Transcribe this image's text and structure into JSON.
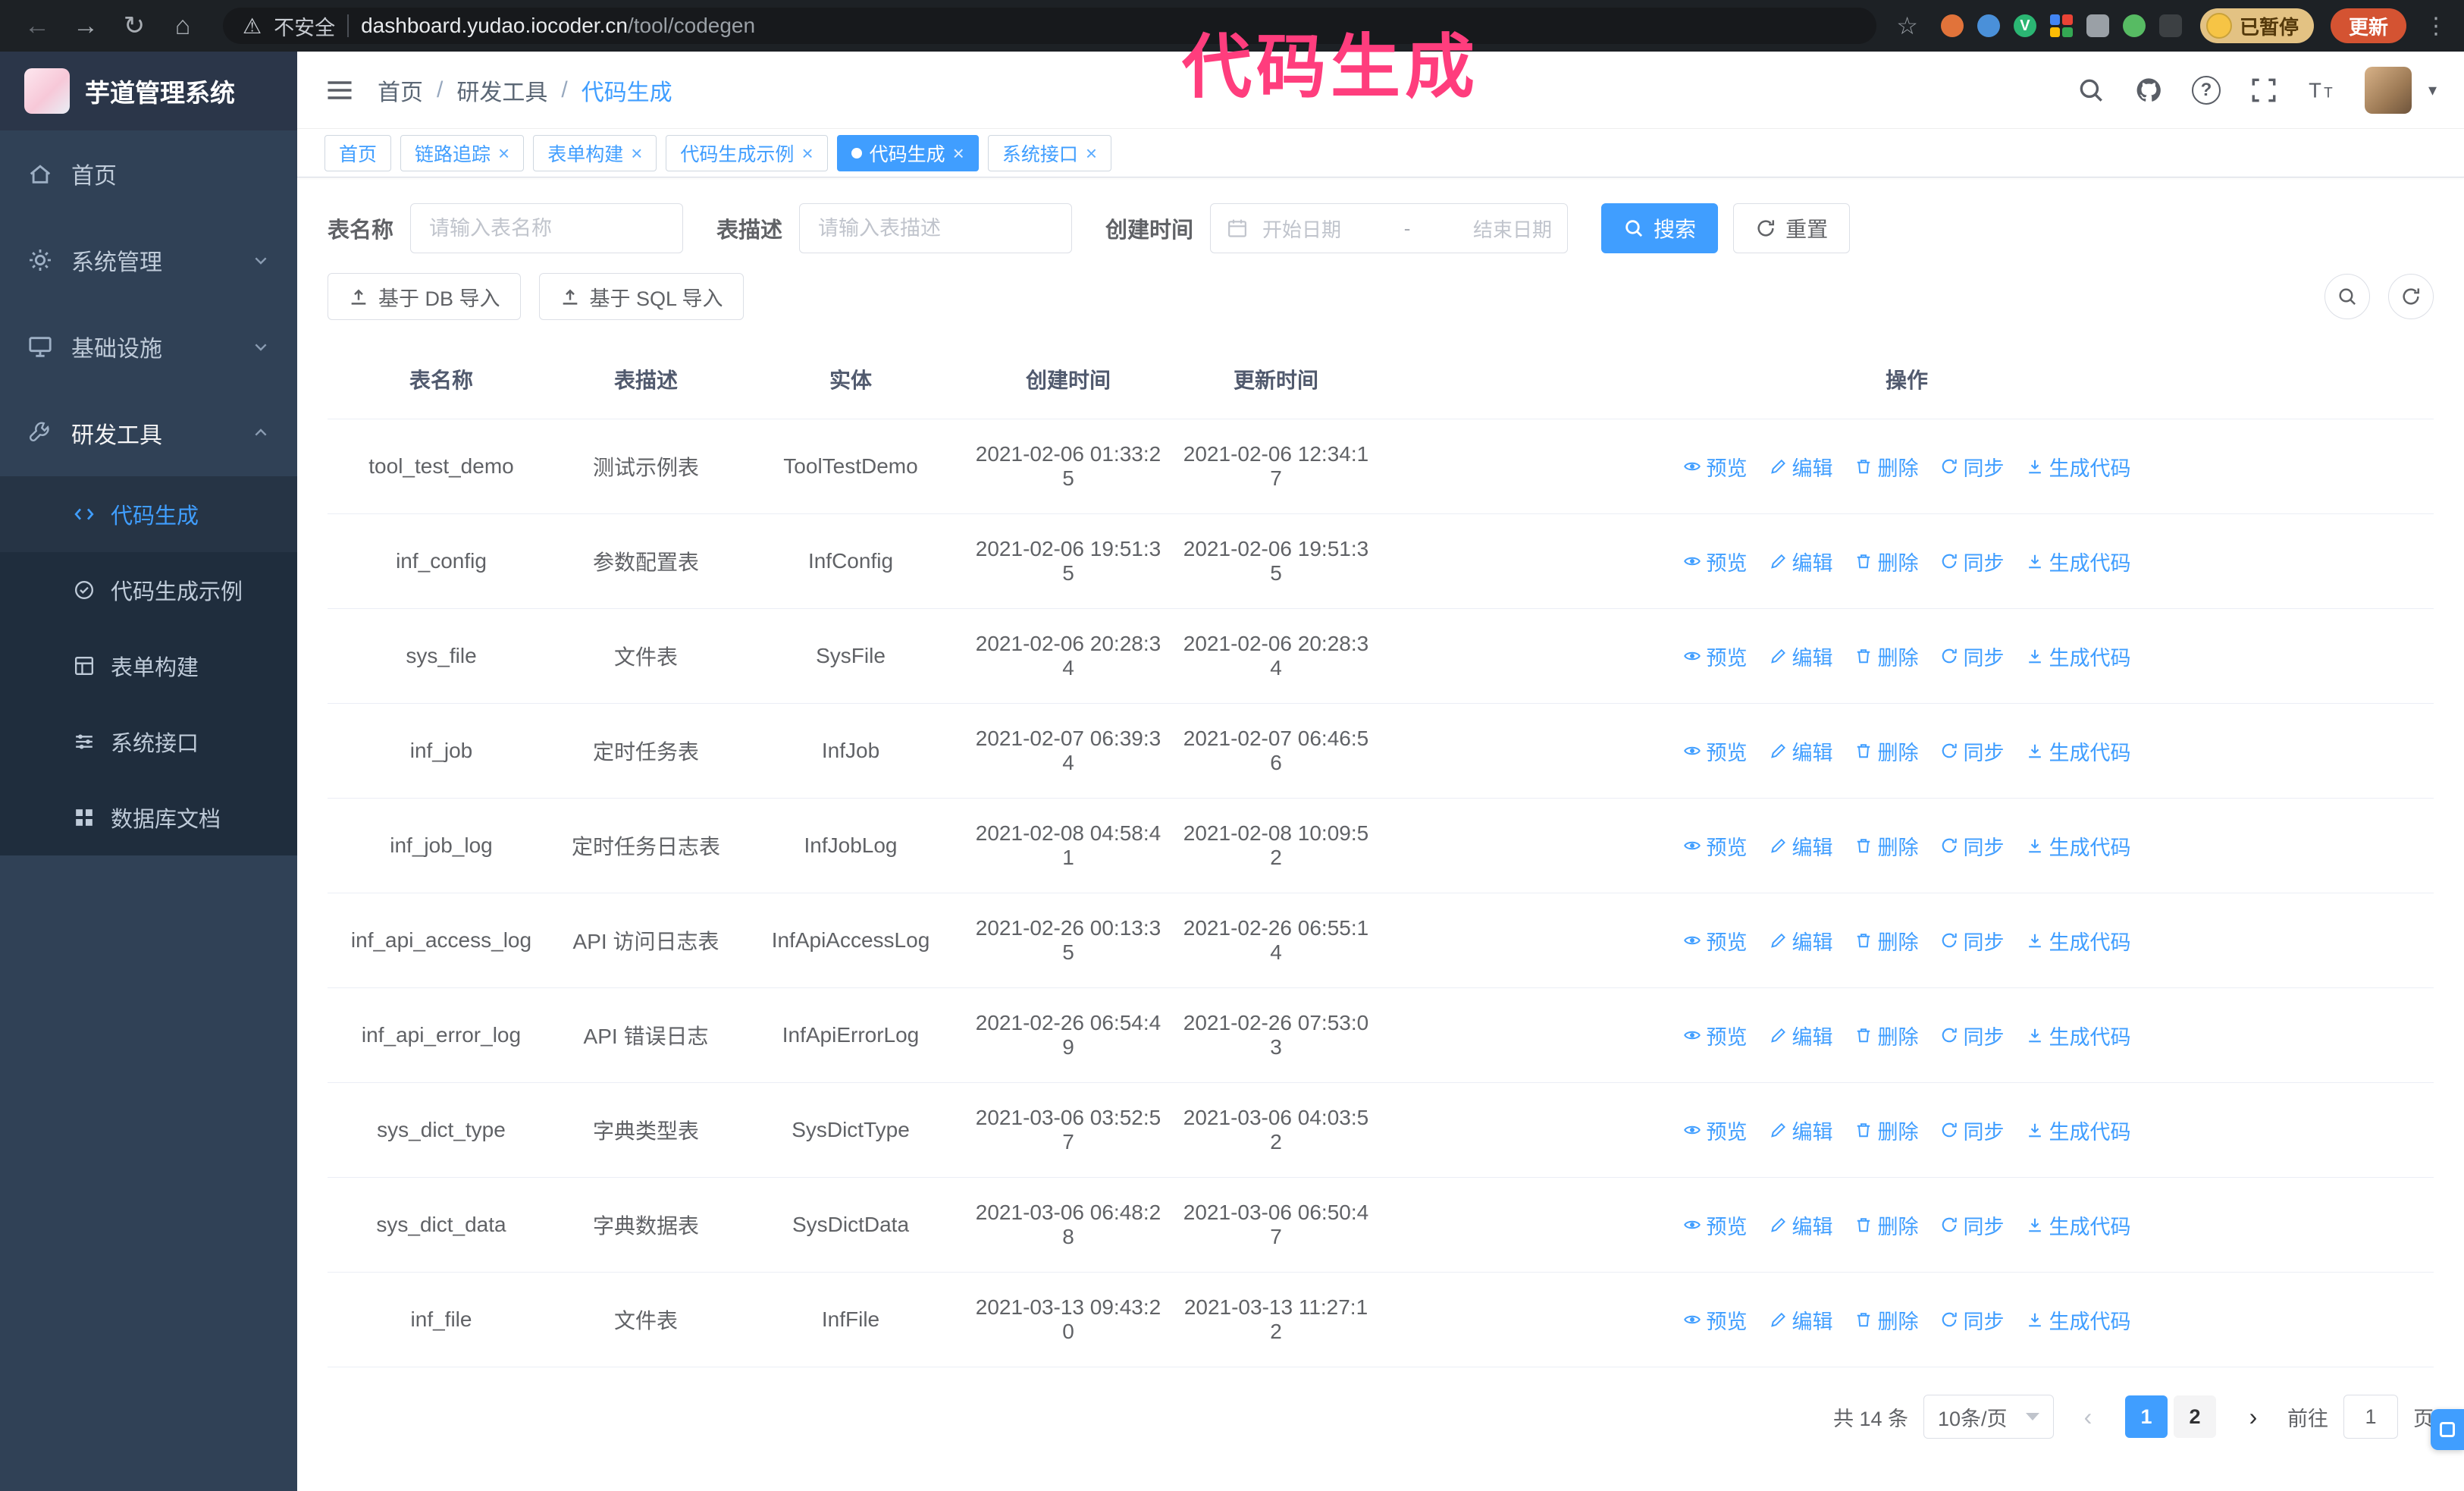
{
  "annotation": {
    "text": "代码生成",
    "color": "#ff3d7d"
  },
  "browser": {
    "not_secure": "不安全",
    "url_host": "dashboard.yudao.iocoder.cn",
    "url_path": "/tool/codegen",
    "paused_badge": "已暂停",
    "update_button": "更新"
  },
  "sidebar": {
    "logo_title": "芋道管理系统",
    "items": [
      {
        "label": "首页"
      },
      {
        "label": "系统管理"
      },
      {
        "label": "基础设施"
      },
      {
        "label": "研发工具"
      }
    ],
    "subitems": [
      {
        "label": "代码生成",
        "active": true
      },
      {
        "label": "代码生成示例",
        "active": false
      },
      {
        "label": "表单构建",
        "active": false
      },
      {
        "label": "系统接口",
        "active": false
      },
      {
        "label": "数据库文档",
        "active": false
      }
    ]
  },
  "header": {
    "breadcrumb": [
      "首页",
      "研发工具",
      "代码生成"
    ],
    "separator": "/"
  },
  "tabs": [
    {
      "label": "首页",
      "closable": false,
      "active": false
    },
    {
      "label": "链路追踪",
      "closable": true,
      "active": false
    },
    {
      "label": "表单构建",
      "closable": true,
      "active": false
    },
    {
      "label": "代码生成示例",
      "closable": true,
      "active": false
    },
    {
      "label": "代码生成",
      "closable": true,
      "active": true
    },
    {
      "label": "系统接口",
      "closable": true,
      "active": false
    }
  ],
  "filters": {
    "table_name_label": "表名称",
    "table_name_placeholder": "请输入表名称",
    "table_desc_label": "表描述",
    "table_desc_placeholder": "请输入表描述",
    "create_time_label": "创建时间",
    "date_start_placeholder": "开始日期",
    "date_separator": "-",
    "date_end_placeholder": "结束日期",
    "search_button": "搜索",
    "reset_button": "重置"
  },
  "toolbar": {
    "import_db_button": "基于 DB 导入",
    "import_sql_button": "基于 SQL 导入"
  },
  "table": {
    "columns": [
      "表名称",
      "表描述",
      "实体",
      "创建时间",
      "更新时间",
      "操作"
    ],
    "actions": [
      "预览",
      "编辑",
      "删除",
      "同步",
      "生成代码"
    ],
    "rows": [
      {
        "name": "tool_test_demo",
        "desc": "测试示例表",
        "entity": "ToolTestDemo",
        "created": "2021-02-06 01:33:25",
        "updated": "2021-02-06 12:34:17"
      },
      {
        "name": "inf_config",
        "desc": "参数配置表",
        "entity": "InfConfig",
        "created": "2021-02-06 19:51:35",
        "updated": "2021-02-06 19:51:35"
      },
      {
        "name": "sys_file",
        "desc": "文件表",
        "entity": "SysFile",
        "created": "2021-02-06 20:28:34",
        "updated": "2021-02-06 20:28:34"
      },
      {
        "name": "inf_job",
        "desc": "定时任务表",
        "entity": "InfJob",
        "created": "2021-02-07 06:39:34",
        "updated": "2021-02-07 06:46:56"
      },
      {
        "name": "inf_job_log",
        "desc": "定时任务日志表",
        "entity": "InfJobLog",
        "created": "2021-02-08 04:58:41",
        "updated": "2021-02-08 10:09:52"
      },
      {
        "name": "inf_api_access_log",
        "desc": "API 访问日志表",
        "entity": "InfApiAccessLog",
        "created": "2021-02-26 00:13:35",
        "updated": "2021-02-26 06:55:14"
      },
      {
        "name": "inf_api_error_log",
        "desc": "API 错误日志",
        "entity": "InfApiErrorLog",
        "created": "2021-02-26 06:54:49",
        "updated": "2021-02-26 07:53:03"
      },
      {
        "name": "sys_dict_type",
        "desc": "字典类型表",
        "entity": "SysDictType",
        "created": "2021-03-06 03:52:57",
        "updated": "2021-03-06 04:03:52"
      },
      {
        "name": "sys_dict_data",
        "desc": "字典数据表",
        "entity": "SysDictData",
        "created": "2021-03-06 06:48:28",
        "updated": "2021-03-06 06:50:47"
      },
      {
        "name": "inf_file",
        "desc": "文件表",
        "entity": "InfFile",
        "created": "2021-03-13 09:43:20",
        "updated": "2021-03-13 11:27:12"
      }
    ]
  },
  "pagination": {
    "total_label": "共 14 条",
    "page_size": "10条/页",
    "pages": [
      {
        "label": "1",
        "active": true
      },
      {
        "label": "2",
        "active": false
      }
    ],
    "goto_label": "前往",
    "goto_value": "1",
    "goto_unit": "页"
  }
}
